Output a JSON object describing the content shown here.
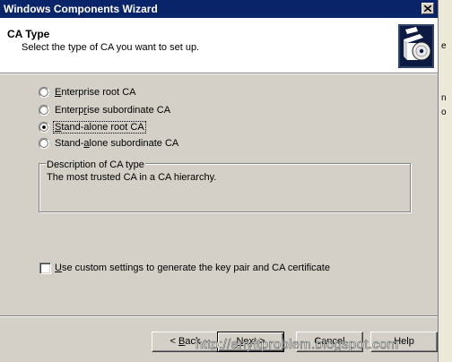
{
  "window": {
    "title": "Windows Components Wizard",
    "close_icon": "close-icon"
  },
  "header": {
    "title": "CA Type",
    "subtitle": "Select the type of CA you want to set up.",
    "icon": "cd-box-icon"
  },
  "ca_type_options": [
    {
      "pre": "",
      "mnemonic": "E",
      "post": "nterprise root CA",
      "selected": false
    },
    {
      "pre": "Enterp",
      "mnemonic": "r",
      "post": "ise subordinate CA",
      "selected": false
    },
    {
      "pre": "",
      "mnemonic": "S",
      "post": "tand-alone root CA",
      "selected": true
    },
    {
      "pre": "Stand-",
      "mnemonic": "a",
      "post": "lone subordinate CA",
      "selected": false
    }
  ],
  "description_group": {
    "legend": "Description of CA type",
    "text": "The most trusted CA in a CA hierarchy."
  },
  "custom_settings": {
    "pre": "",
    "mnemonic": "U",
    "post": "se custom settings to generate the key pair and CA certificate",
    "checked": false
  },
  "buttons": {
    "back_pre": "< ",
    "back_mnemonic": "B",
    "back_post": "ack",
    "next_mnemonic": "N",
    "next_post": "ext >",
    "cancel": "Cancel",
    "help": "Help"
  },
  "watermark": "http://anyitproblem.blogspot.com"
}
